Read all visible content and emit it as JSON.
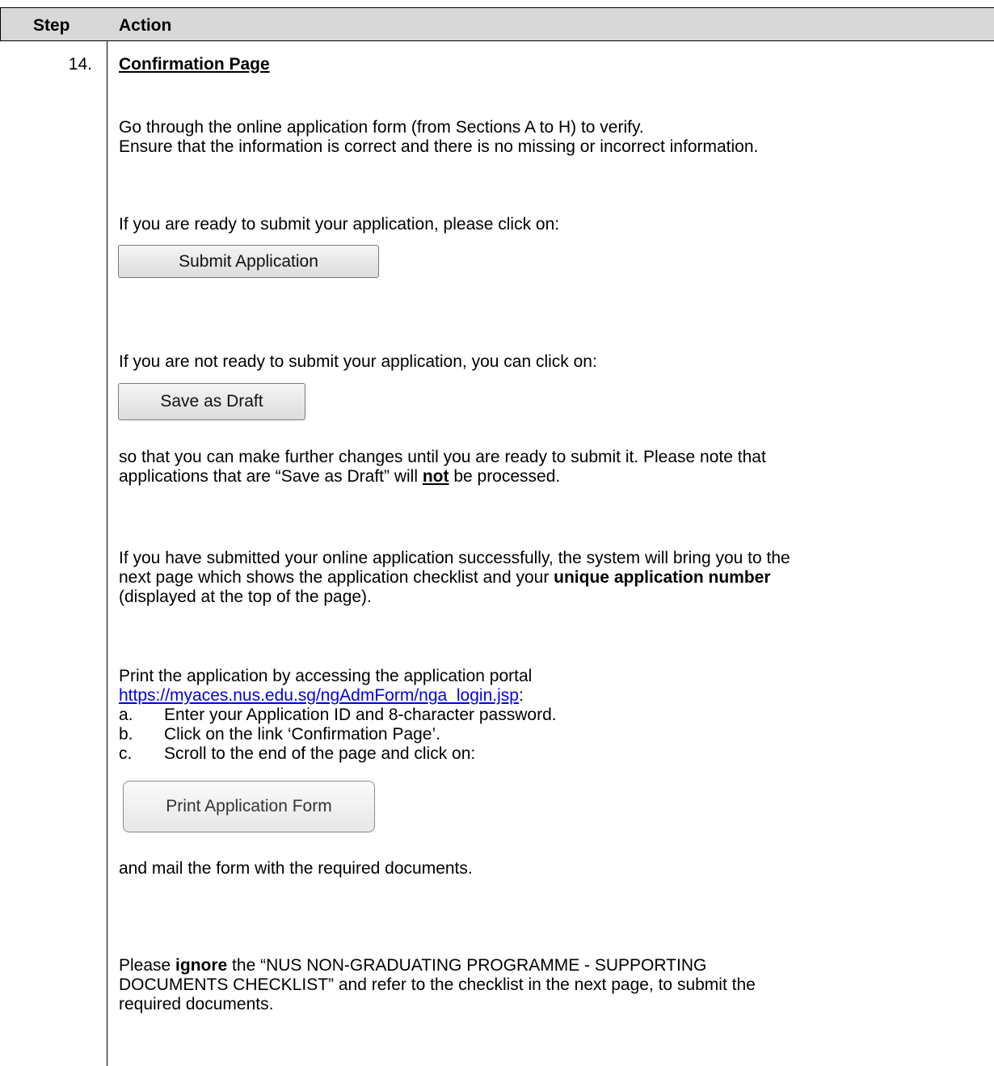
{
  "table": {
    "headers": {
      "step": "Step",
      "action": "Action"
    },
    "step_number": "14.",
    "section_title": "Confirmation Page"
  },
  "paragraphs": {
    "verify_line1": "Go through the online application form (from Sections A to H) to verify.",
    "verify_line2": "Ensure that the information is correct and there is no missing or incorrect information.",
    "ready_submit": "If you are ready to submit your application, please click on:",
    "not_ready": "If you are not ready to submit your application, you can click on:",
    "draft_note_line1": "so that you can make further changes until you are ready to submit it. Please note that",
    "draft_note_line2_pre": "applications that are “Save as Draft” will ",
    "draft_note_line2_bold": "not",
    "draft_note_line2_post": " be processed.",
    "submitted_line1": "If you have submitted your online application successfully, the system will bring you to the",
    "submitted_line2_pre": "next page which shows the application checklist and your ",
    "submitted_line2_bold": "unique application number",
    "submitted_line3": "(displayed at the top of the page).",
    "print_intro": "Print the application by accessing the application portal",
    "portal_link": "https://myaces.nus.edu.sg/ngAdmForm/nga_login.jsp",
    "portal_link_suffix": ":",
    "mail_form": "and mail the form with the required documents.",
    "ignore_pre": "Please ",
    "ignore_bold": "ignore",
    "ignore_post": " the “NUS NON-GRADUATING PROGRAMME - SUPPORTING",
    "ignore_line2": "DOCUMENTS CHECKLIST” and refer to the checklist in the next page, to submit the",
    "ignore_line3": "required documents."
  },
  "steps_list": [
    {
      "marker": "a.",
      "text": "Enter your Application ID and 8-character password."
    },
    {
      "marker": "b.",
      "text": "Click on the link ‘Confirmation Page’."
    },
    {
      "marker": "c.",
      "text": "Scroll to the end of the page and click on:"
    }
  ],
  "buttons": {
    "submit_application": "Submit Application",
    "save_as_draft": "Save as Draft",
    "print_application_form": "Print Application Form"
  }
}
